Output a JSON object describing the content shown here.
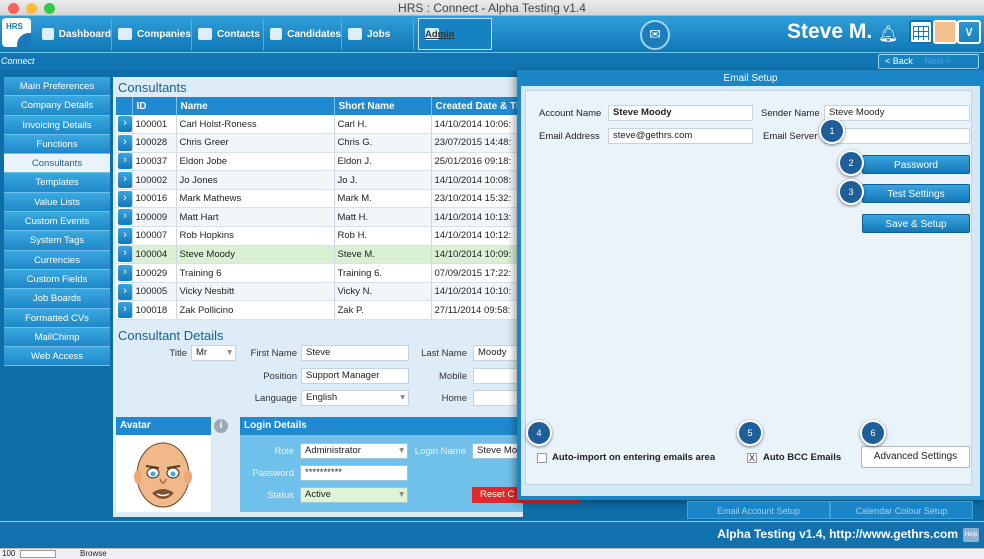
{
  "window": {
    "title": "HRS : Connect - Alpha Testing v1.4"
  },
  "nav": {
    "logo_text": "HRS",
    "items": [
      {
        "label": "Dashboard"
      },
      {
        "label": "Companies"
      },
      {
        "label": "Contacts"
      },
      {
        "label": "Candidates"
      },
      {
        "label": "Jobs"
      },
      {
        "label": "Admin"
      }
    ],
    "user_name": "Steve M."
  },
  "subbar": {
    "breadcrumb": "Connect",
    "back_label": "< Back",
    "next_label": "Next >"
  },
  "sidebar": {
    "items": [
      {
        "label": "Main Preferences"
      },
      {
        "label": "Company Details"
      },
      {
        "label": "Invoicing Details"
      },
      {
        "label": "Functions"
      },
      {
        "label": "Consultants"
      },
      {
        "label": "Templates"
      },
      {
        "label": "Value Lists"
      },
      {
        "label": "Custom Events"
      },
      {
        "label": "System Tags"
      },
      {
        "label": "Currencies"
      },
      {
        "label": "Custom Fields"
      },
      {
        "label": "Job Boards"
      },
      {
        "label": "Formatted CVs"
      },
      {
        "label": "MailChimp"
      },
      {
        "label": "Web Access"
      }
    ]
  },
  "consultants": {
    "title": "Consultants",
    "columns": [
      "ID",
      "Name",
      "Short Name",
      "Created Date & Time"
    ],
    "rows": [
      {
        "id": "100001",
        "name": "Carl Holst-Roness",
        "short": "Carl H.",
        "date": "14/10/2014 10:06:"
      },
      {
        "id": "100028",
        "name": "Chris Greer",
        "short": "Chris G.",
        "date": "23/07/2015 14:48:"
      },
      {
        "id": "100037",
        "name": "Eldon Jobe",
        "short": "Eldon J.",
        "date": "25/01/2016 09:18:"
      },
      {
        "id": "100002",
        "name": "Jo Jones",
        "short": "Jo J.",
        "date": "14/10/2014 10:08:"
      },
      {
        "id": "100016",
        "name": "Mark Mathews",
        "short": "Mark M.",
        "date": "23/10/2014 15:32:"
      },
      {
        "id": "100009",
        "name": "Matt Hart",
        "short": "Matt H.",
        "date": "14/10/2014 10:13:"
      },
      {
        "id": "100007",
        "name": "Rob Hopkins",
        "short": "Rob H.",
        "date": "14/10/2014 10:12:"
      },
      {
        "id": "100004",
        "name": "Steve Moody",
        "short": "Steve M.",
        "date": "14/10/2014 10:09:"
      },
      {
        "id": "100029",
        "name": "Training 6",
        "short": "Training 6.",
        "date": "07/09/2015 17:22:"
      },
      {
        "id": "100005",
        "name": "Vicky Nesbitt",
        "short": "Vicky N.",
        "date": "14/10/2014 10:10:"
      },
      {
        "id": "100018",
        "name": "Zak Pollicino",
        "short": "Zak P.",
        "date": "27/11/2014 09:58:"
      }
    ]
  },
  "details": {
    "title": "Consultant Details",
    "title_label": "Title",
    "title_value": "Mr",
    "first_name_label": "First Name",
    "first_name": "Steve",
    "last_name_label": "Last Name",
    "last_name": "Moody",
    "position_label": "Position",
    "position": "Support Manager",
    "mobile_label": "Mobile",
    "language_label": "Language",
    "language": "English",
    "home_label": "Home"
  },
  "avatar": {
    "title": "Avatar"
  },
  "login": {
    "title": "Login Details",
    "role_label": "Role",
    "role": "Administrator",
    "login_name_label": "Login Name",
    "login_name": "Steve Mo",
    "password_label": "Password",
    "password": "**********",
    "status_label": "Status",
    "status": "Active",
    "reset_label": "Reset C"
  },
  "email_setup": {
    "title": "Email Setup",
    "account_name_label": "Account Name",
    "account_name": "Steve Moody",
    "sender_name_label": "Sender Name",
    "sender_name": "Steve Moody",
    "email_address_label": "Email Address",
    "email_address": "steve@gethrs.com",
    "email_server_label": "Email Server",
    "password_btn": "Password",
    "test_settings_btn": "Test Settings",
    "save_setup_btn": "Save & Setup",
    "auto_import_label": "Auto-import on entering emails area",
    "auto_bcc_label": "Auto BCC Emails",
    "auto_bcc_mark": "X",
    "advanced_btn": "Advanced Settings",
    "badges": [
      "1",
      "2",
      "3",
      "4",
      "5",
      "6"
    ],
    "tabs": [
      "Email Account Setup",
      "Calendar Colour Setup"
    ]
  },
  "footer": {
    "text": "Alpha Testing v1.4, http://www.gethrs.com",
    "help": "Help"
  },
  "statusbar": {
    "zoom": "100",
    "mode": "Browse"
  },
  "colors": {
    "accent": "#1a86c8",
    "danger": "#e02a2a",
    "selected_row": "#d9f0d2"
  }
}
